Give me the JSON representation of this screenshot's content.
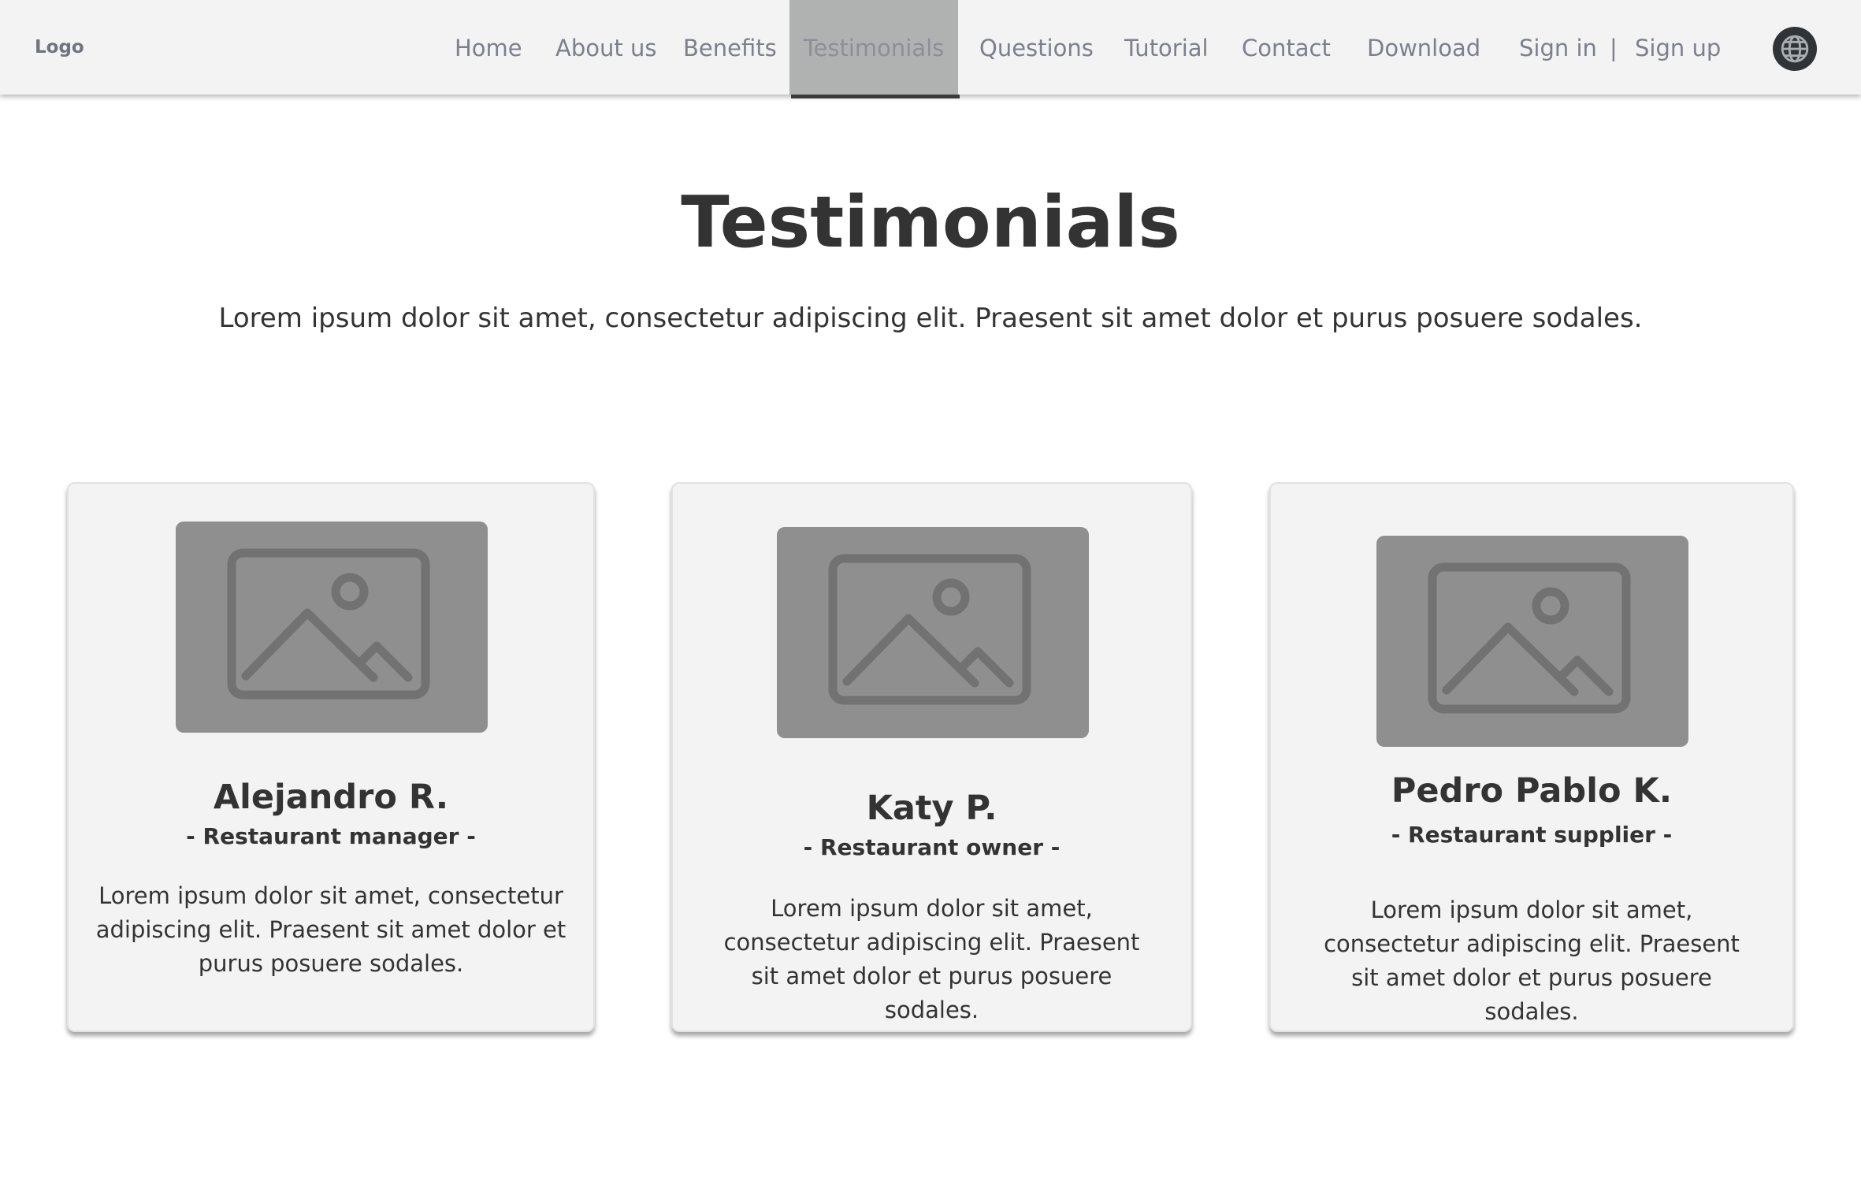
{
  "header": {
    "logo": "Logo",
    "nav": [
      {
        "label": "Home"
      },
      {
        "label": "About us"
      },
      {
        "label": "Benefits"
      },
      {
        "label": "Testimonials",
        "active": true
      },
      {
        "label": "Questions"
      },
      {
        "label": "Tutorial"
      },
      {
        "label": "Contact"
      },
      {
        "label": "Download"
      }
    ],
    "sign_in": "Sign in",
    "separator": "|",
    "sign_up": "Sign up",
    "language_icon": "globe-icon"
  },
  "main": {
    "title": "Testimonials",
    "subtitle": "Lorem ipsum dolor sit amet, consectetur adipiscing elit. Praesent sit amet dolor et purus posuere sodales.",
    "testimonials": [
      {
        "name": "Alejandro R.",
        "role": "- Restaurant manager -",
        "text": "Lorem ipsum dolor sit amet, consectetur adipiscing elit. Praesent sit amet dolor et purus posuere sodales.",
        "image_icon": "image-placeholder-icon"
      },
      {
        "name": "Katy P.",
        "role": "- Restaurant owner -",
        "text": "Lorem ipsum dolor sit amet, consectetur adipiscing elit. Praesent sit amet dolor et purus posuere sodales.",
        "image_icon": "image-placeholder-icon"
      },
      {
        "name": "Pedro Pablo K.",
        "role": "- Restaurant supplier -",
        "text": "Lorem ipsum dolor sit amet, consectetur adipiscing elit. Praesent sit amet dolor et purus posuere sodales.",
        "image_icon": "image-placeholder-icon"
      }
    ]
  },
  "colors": {
    "nav_background": "#f3f3f3",
    "active_tab_background": "#b0b2b2",
    "active_tab_indicator": "#3a3a3a",
    "nav_text": "#7a8090",
    "card_background": "#f3f3f3",
    "image_placeholder": "#8f8f8f",
    "heading_text": "#333333"
  }
}
